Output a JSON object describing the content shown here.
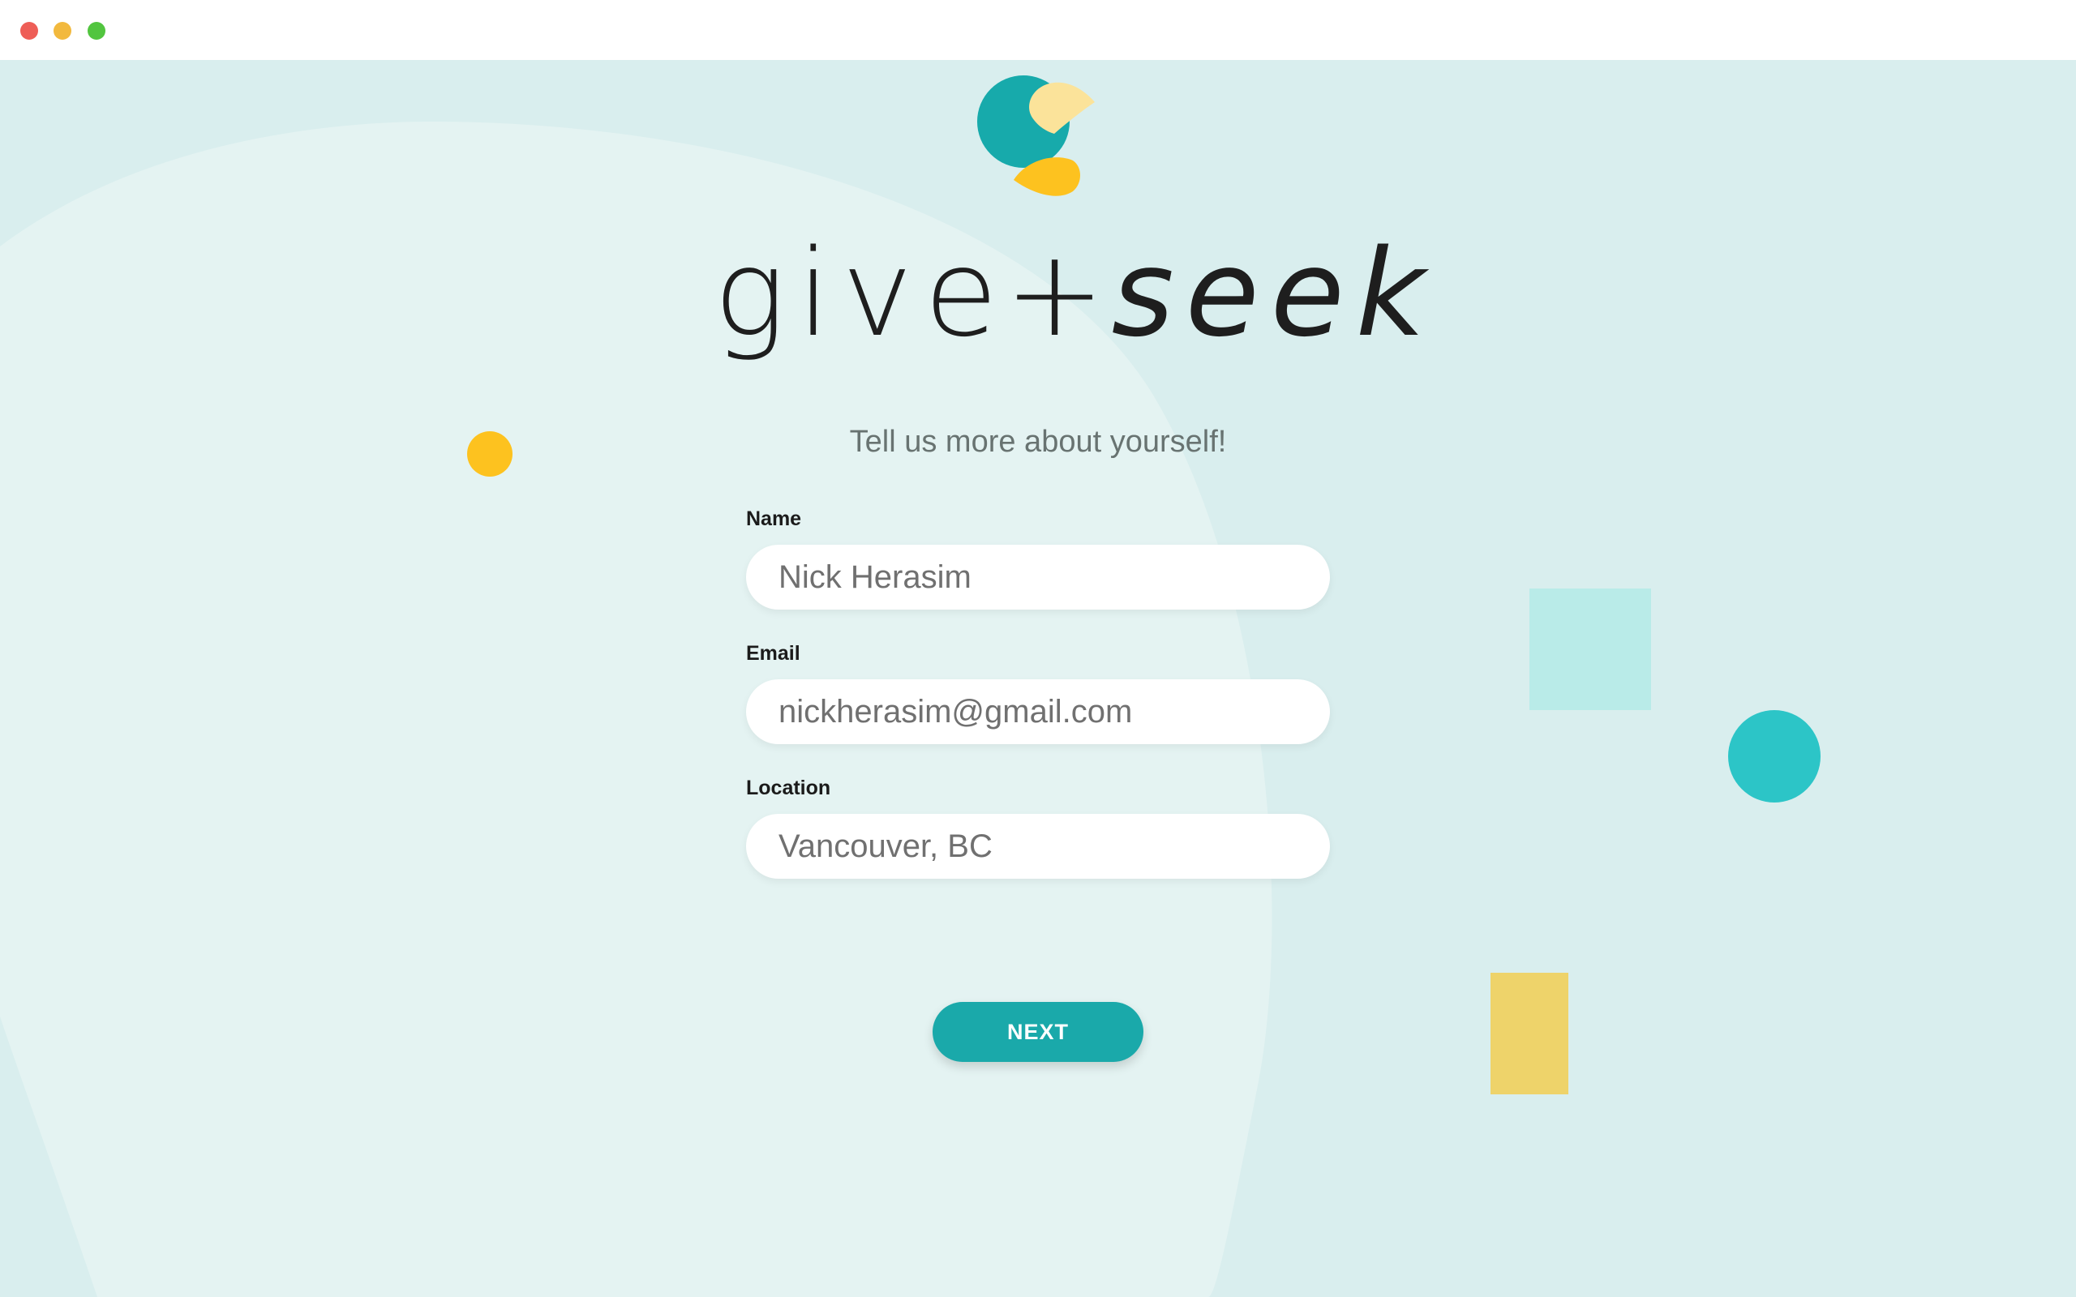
{
  "window": {
    "controls": [
      "close",
      "minimize",
      "maximize"
    ]
  },
  "brand": {
    "word_left": "give",
    "plus": "+",
    "word_right": "seek",
    "colors": {
      "teal": "#1aa9aa",
      "yellow": "#fdc21f",
      "pale_yellow": "#fbe39a",
      "background": "#d9eeee"
    }
  },
  "form": {
    "subtitle": "Tell us more about yourself!",
    "name_label": "Name",
    "name_value": "Nick Herasim",
    "email_label": "Email",
    "email_value": "nickherasim@gmail.com",
    "location_label": "Location",
    "location_value": "Vancouver, BC",
    "next_label": "NEXT"
  },
  "icons": {
    "close": "close-icon",
    "minimize": "minimize-icon",
    "maximize": "maximize-icon",
    "logo": "give-seek-logo-icon"
  }
}
